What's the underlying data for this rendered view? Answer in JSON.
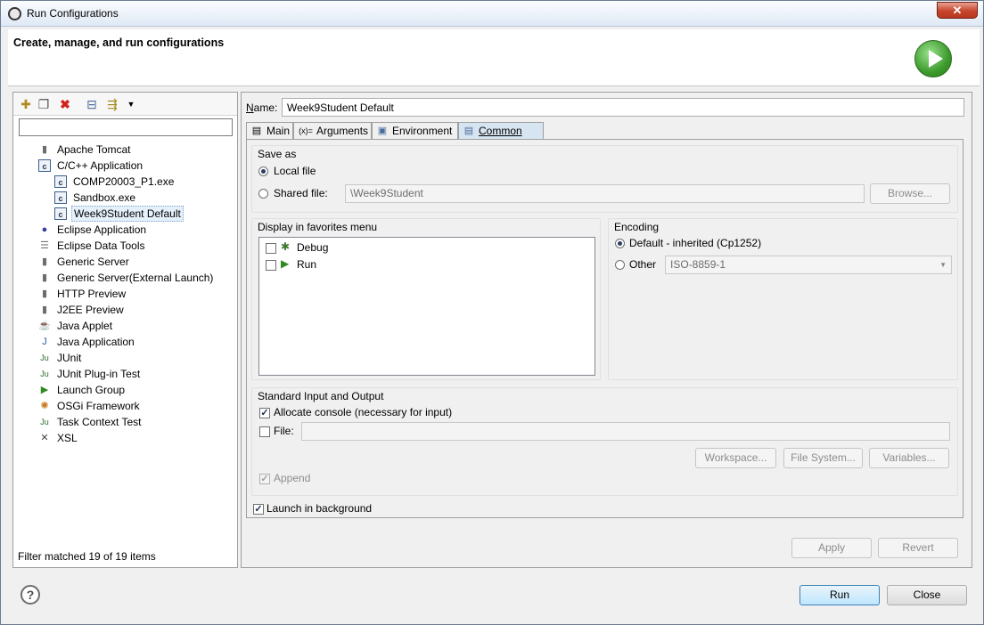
{
  "window": {
    "title": "Run Configurations",
    "close_label": "✕"
  },
  "header": {
    "title": "Create, manage, and run configurations"
  },
  "left": {
    "filter_value": "",
    "tree": [
      {
        "label": "Apache Tomcat",
        "icon": "server-icon",
        "glyph": "▮"
      },
      {
        "label": "C/C++ Application",
        "icon": "c-app-icon",
        "glyph": "c"
      },
      {
        "label": "COMP20003_P1.exe",
        "icon": "c-app-icon",
        "glyph": "c"
      },
      {
        "label": "Sandbox.exe",
        "icon": "c-app-icon",
        "glyph": "c"
      },
      {
        "label": "Week9Student Default",
        "icon": "c-app-icon",
        "glyph": "c"
      },
      {
        "label": "Eclipse Application",
        "icon": "eclipse-icon",
        "glyph": "●"
      },
      {
        "label": "Eclipse Data Tools",
        "icon": "database-icon",
        "glyph": "☰"
      },
      {
        "label": "Generic Server",
        "icon": "server-icon",
        "glyph": "▮"
      },
      {
        "label": "Generic Server(External Launch)",
        "icon": "server-icon",
        "glyph": "▮"
      },
      {
        "label": "HTTP Preview",
        "icon": "server-icon",
        "glyph": "▮"
      },
      {
        "label": "J2EE Preview",
        "icon": "server-icon",
        "glyph": "▮"
      },
      {
        "label": "Java Applet",
        "icon": "java-applet-icon",
        "glyph": "☕"
      },
      {
        "label": "Java Application",
        "icon": "java-app-icon",
        "glyph": "J"
      },
      {
        "label": "JUnit",
        "icon": "junit-icon",
        "glyph": "Ju"
      },
      {
        "label": "JUnit Plug-in Test",
        "icon": "junit-plugin-icon",
        "glyph": "Ju"
      },
      {
        "label": "Launch Group",
        "icon": "launch-group-icon",
        "glyph": "▶"
      },
      {
        "label": "OSGi Framework",
        "icon": "osgi-icon",
        "glyph": "✺"
      },
      {
        "label": "Task Context Test",
        "icon": "junit-icon",
        "glyph": "Ju"
      },
      {
        "label": "XSL",
        "icon": "xsl-icon",
        "glyph": "✕"
      }
    ],
    "filter_status": "Filter matched 19 of 19 items"
  },
  "right": {
    "name_label": "Name:",
    "name_value": "Week9Student Default",
    "tabs": [
      {
        "label": "Main",
        "icon": "main-tab-icon",
        "glyph": "▤"
      },
      {
        "label": "Arguments",
        "icon": "arguments-icon",
        "glyph": "(x)="
      },
      {
        "label": "Environment",
        "icon": "environment-icon",
        "glyph": "▣"
      },
      {
        "label": "Common",
        "icon": "common-icon",
        "glyph": "▤"
      }
    ],
    "save_as": {
      "title": "Save as",
      "local_file": "Local file",
      "shared_file": "Shared file:",
      "shared_path": "\\Week9Student",
      "browse": "Browse..."
    },
    "favorites": {
      "title": "Display in favorites menu",
      "items": [
        "Debug",
        "Run"
      ]
    },
    "encoding": {
      "title": "Encoding",
      "default_label": "Default - inherited (Cp1252)",
      "other_label": "Other",
      "other_value": "ISO-8859-1"
    },
    "io": {
      "title": "Standard Input and Output",
      "allocate_console": "Allocate console (necessary for input)",
      "file_label": "File:",
      "file_value": "",
      "workspace": "Workspace...",
      "file_system": "File System...",
      "variables": "Variables...",
      "append": "Append"
    },
    "launch_bg": "Launch in background",
    "apply": "Apply",
    "revert": "Revert"
  },
  "footer": {
    "help": "?",
    "run": "Run",
    "close": "Close"
  }
}
